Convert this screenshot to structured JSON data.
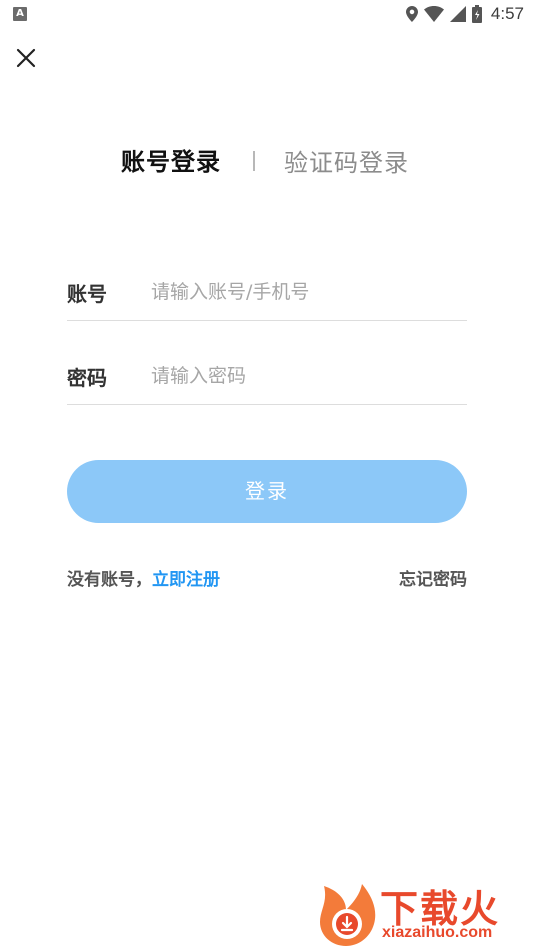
{
  "status_bar": {
    "app_icon": "A",
    "time": "4:57",
    "icons": [
      "location-icon",
      "wifi-icon",
      "signal-icon",
      "battery-icon"
    ]
  },
  "tabs": {
    "account_login": "账号登录",
    "code_login": "验证码登录"
  },
  "form": {
    "account_label": "账号",
    "account_placeholder": "请输入账号/手机号",
    "password_label": "密码",
    "password_placeholder": "请输入密码"
  },
  "login_button": "登录",
  "footer": {
    "no_account": "没有账号，",
    "register": "立即注册",
    "forgot": "忘记密码"
  },
  "watermark": {
    "brand": "下载火",
    "url": "xiazaihuo.com"
  },
  "colors": {
    "accent": "#2196f3",
    "button": "#8cc8f8",
    "watermark": "#e8492c"
  }
}
